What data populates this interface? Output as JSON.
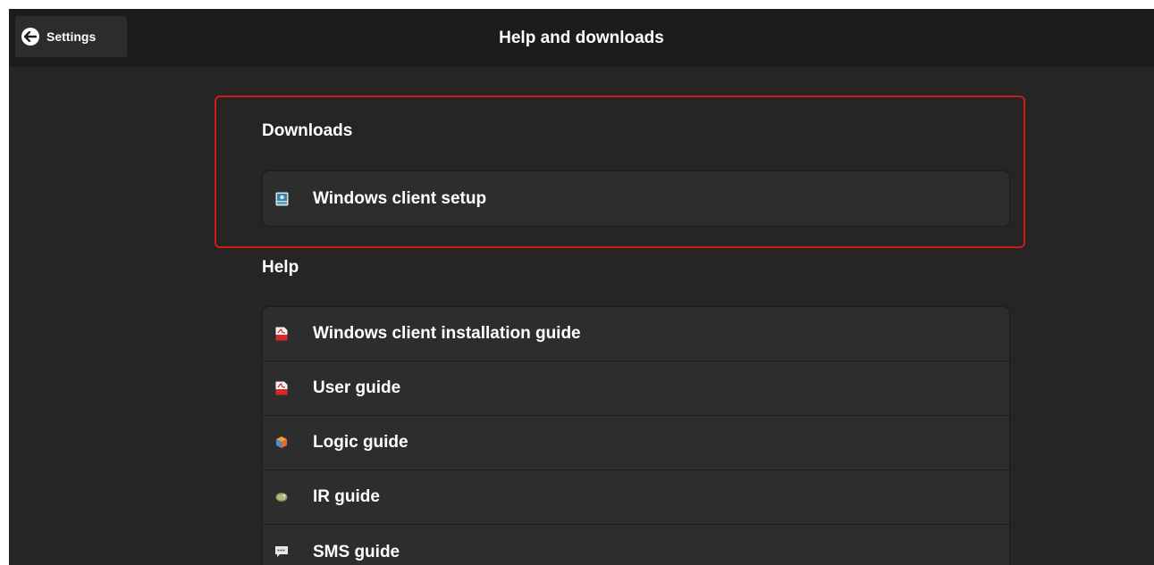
{
  "header": {
    "back_label": "Settings",
    "title": "Help and downloads"
  },
  "downloads": {
    "heading": "Downloads",
    "items": [
      {
        "label": "Windows client setup",
        "icon": "installer-icon"
      }
    ]
  },
  "help": {
    "heading": "Help",
    "items": [
      {
        "label": "Windows client installation guide",
        "icon": "pdf-icon"
      },
      {
        "label": "User guide",
        "icon": "pdf-icon"
      },
      {
        "label": "Logic guide",
        "icon": "logic-blocks-icon"
      },
      {
        "label": "IR guide",
        "icon": "ir-sensor-icon"
      },
      {
        "label": "SMS guide",
        "icon": "sms-icon"
      }
    ]
  },
  "colors": {
    "background": "#252525",
    "header": "#1c1c1c",
    "card": "#2d2d2d",
    "highlight": "#d01a1a"
  }
}
